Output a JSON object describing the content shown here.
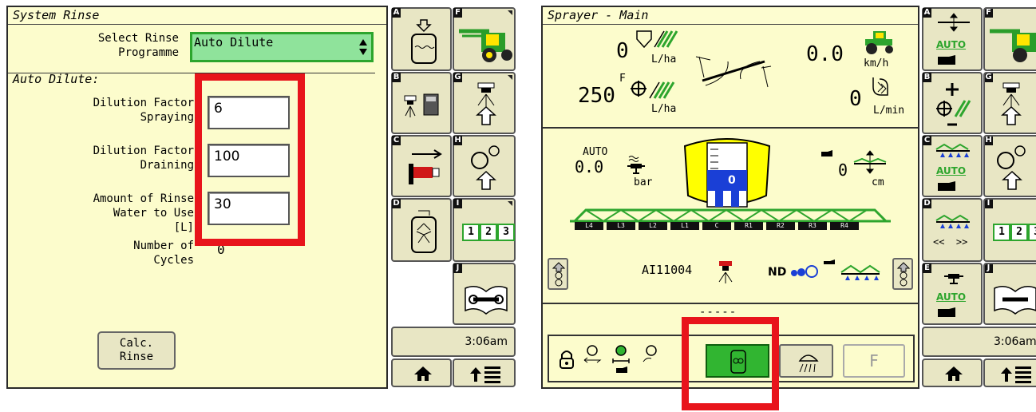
{
  "left": {
    "title": "System Rinse",
    "programme_label_1": "Select Rinse",
    "programme_label_2": "Programme",
    "programme_value": "Auto Dilute",
    "section_title": "Auto Dilute:",
    "fields": [
      {
        "label_1": "Dilution Factor",
        "label_2": "Spraying",
        "value": "6"
      },
      {
        "label_1": "Dilution Factor",
        "label_2": "Draining",
        "value": "100"
      },
      {
        "label_1": "Amount of Rinse",
        "label_2": "Water to Use",
        "label_3": "[L]",
        "value": "30"
      }
    ],
    "cycles_label_1": "Number of",
    "cycles_label_2": "Cycles",
    "cycles_value": "0",
    "calc_button_1": "Calc.",
    "calc_button_2": "Rinse",
    "softkeys": {
      "A": "A",
      "B": "B",
      "C": "C",
      "D": "D",
      "F": "F",
      "G": "G",
      "H": "H",
      "I": "I",
      "J": "J"
    },
    "keypad_digits": [
      "1",
      "2",
      "3"
    ],
    "time": "3:06am"
  },
  "right": {
    "title": "Sprayer - Main",
    "rate_actual": "0",
    "rate_unit": "L/ha",
    "speed": "0.0",
    "speed_unit": "km/h",
    "rate_target_prefix": "F",
    "rate_target": "250",
    "rate_target_unit": "L/ha",
    "flow": "0",
    "flow_unit": "L/min",
    "pressure_mode": "AUTO",
    "pressure": "0.0",
    "pressure_unit": "bar",
    "tank_level": "0",
    "height": "0",
    "height_unit": "cm",
    "sections": [
      "L4",
      "L3",
      "L2",
      "L1",
      "C",
      "R1",
      "R2",
      "R3",
      "R4"
    ],
    "nozzle": "AI11004",
    "nd_label": "ND",
    "dashes": "-----",
    "bottom_f": "F",
    "softkeys": {
      "A": "A",
      "B": "B",
      "C": "C",
      "D": "D",
      "E": "E",
      "F": "F",
      "G": "G",
      "H": "H",
      "I": "I",
      "J": "J"
    },
    "auto_label": "AUTO",
    "section_arrows": "<<  >>",
    "keypad_digits": [
      "1",
      "2",
      "3"
    ],
    "time": "3:06am"
  },
  "colors": {
    "screen_bg": "#fcfccc",
    "accent_green": "#31b531",
    "highlight_red": "#e8141b",
    "tank_yellow": "#ffff00",
    "tank_blue": "#1a3fd6"
  }
}
